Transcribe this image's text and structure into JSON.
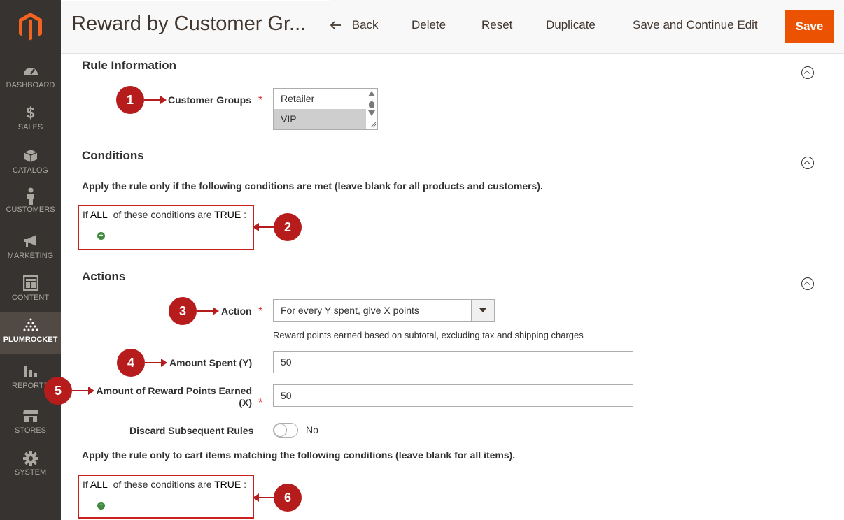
{
  "sidebar": {
    "items": [
      {
        "label": "DASHBOARD",
        "icon": "dashboard-icon"
      },
      {
        "label": "SALES",
        "icon": "dollar-icon"
      },
      {
        "label": "CATALOG",
        "icon": "box-icon"
      },
      {
        "label": "CUSTOMERS",
        "icon": "person-icon"
      },
      {
        "label": "MARKETING",
        "icon": "megaphone-icon"
      },
      {
        "label": "CONTENT",
        "icon": "layout-icon"
      },
      {
        "label": "PLUMROCKET",
        "icon": "plumrocket-icon"
      },
      {
        "label": "REPORTS",
        "icon": "bar-chart-icon"
      },
      {
        "label": "STORES",
        "icon": "storefront-icon"
      },
      {
        "label": "SYSTEM",
        "icon": "gear-icon"
      }
    ]
  },
  "header": {
    "title": "Reward by Customer Gr...",
    "back_label": "Back",
    "delete_label": "Delete",
    "reset_label": "Reset",
    "duplicate_label": "Duplicate",
    "save_continue_label": "Save and Continue Edit",
    "save_label": "Save"
  },
  "rule_info": {
    "title": "Rule Information",
    "customer_groups_label": "Customer Groups",
    "required_mark": "*",
    "options": [
      {
        "label": "Retailer",
        "selected": false
      },
      {
        "label": "VIP",
        "selected": true
      }
    ]
  },
  "conditions": {
    "title": "Conditions",
    "description": "Apply the rule only if the following conditions are met (leave blank for all products and customers).",
    "prefix": "If",
    "aggregator": "ALL",
    "middle": "of these conditions are",
    "value": "TRUE",
    "suffix": ":"
  },
  "actions": {
    "title": "Actions",
    "action_label": "Action",
    "action_value": "For every Y spent, give X points",
    "action_help": "Reward points earned based on subtotal, excluding tax and shipping charges",
    "amount_spent_label": "Amount Spent (Y)",
    "amount_spent_value": "50",
    "points_label_line1": "Amount of Reward Points Earned",
    "points_label_line2": "(X)",
    "points_value": "50",
    "discard_label": "Discard Subsequent Rules",
    "discard_value": "No",
    "cart_description": "Apply the rule only to cart items matching the following conditions (leave blank for all items).",
    "cart_prefix": "If",
    "cart_aggregator": "ALL",
    "cart_middle": "of these conditions are",
    "cart_value": "TRUE",
    "cart_suffix": ":"
  },
  "callouts": [
    "1",
    "2",
    "3",
    "4",
    "5",
    "6"
  ],
  "colors": {
    "sidebar_bg": "#373330",
    "accent": "#eb5202",
    "callout": "#b71c1c",
    "required": "#e22626"
  }
}
